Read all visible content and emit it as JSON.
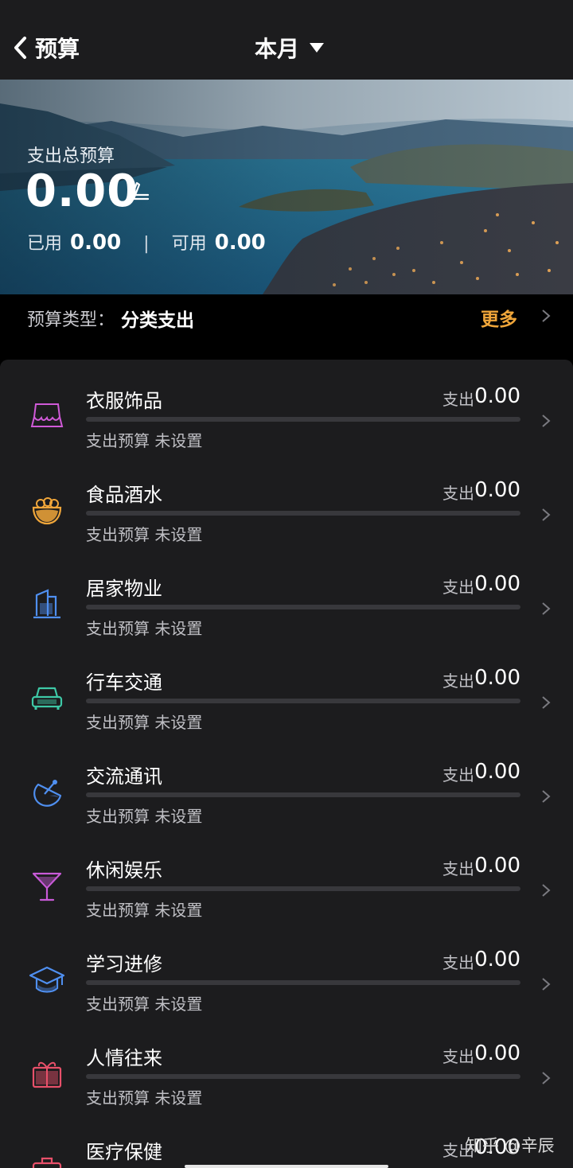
{
  "header": {
    "back_label": "预算",
    "period_label": "本月"
  },
  "hero": {
    "title": "支出总预算",
    "total": "0.00",
    "used_label": "已用",
    "used_value": "0.00",
    "divider": "|",
    "available_label": "可用",
    "available_value": "0.00"
  },
  "budget_type": {
    "label": "预算类型：",
    "value": "分类支出",
    "more_label": "更多"
  },
  "categories": [
    {
      "name": "衣服饰品",
      "spend_label": "支出",
      "amount": "0.00",
      "budget_text": "支出预算 未设置",
      "icon": "clothing-icon",
      "color": "#d05ad8"
    },
    {
      "name": "食品酒水",
      "spend_label": "支出",
      "amount": "0.00",
      "budget_text": "支出预算 未设置",
      "icon": "food-bowl-icon",
      "color": "#f0a63a"
    },
    {
      "name": "居家物业",
      "spend_label": "支出",
      "amount": "0.00",
      "budget_text": "支出预算 未设置",
      "icon": "building-icon",
      "color": "#4f8ff0"
    },
    {
      "name": "行车交通",
      "spend_label": "支出",
      "amount": "0.00",
      "budget_text": "支出预算 未设置",
      "icon": "car-icon",
      "color": "#3ec9a7"
    },
    {
      "name": "交流通讯",
      "spend_label": "支出",
      "amount": "0.00",
      "budget_text": "支出预算 未设置",
      "icon": "satellite-dish-icon",
      "color": "#4f8ff0"
    },
    {
      "name": "休闲娱乐",
      "spend_label": "支出",
      "amount": "0.00",
      "budget_text": "支出预算 未设置",
      "icon": "cocktail-icon",
      "color": "#c85ad8"
    },
    {
      "name": "学习进修",
      "spend_label": "支出",
      "amount": "0.00",
      "budget_text": "支出预算 未设置",
      "icon": "graduation-cap-icon",
      "color": "#4f8ff0"
    },
    {
      "name": "人情往来",
      "spend_label": "支出",
      "amount": "0.00",
      "budget_text": "支出预算 未设置",
      "icon": "gift-icon",
      "color": "#e8506a"
    },
    {
      "name": "医疗保健",
      "spend_label": "支出",
      "amount": "0.00",
      "budget_text": "",
      "icon": "medical-kit-icon",
      "color": "#e8506a"
    }
  ],
  "watermark": "知乎 @辛辰"
}
